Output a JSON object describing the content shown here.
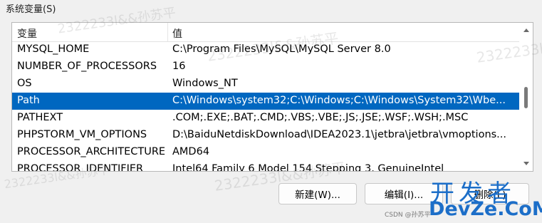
{
  "group_title": "系统变量(S)",
  "table": {
    "headers": {
      "name": "变量",
      "value": "值"
    },
    "rows": [
      {
        "name": "MYSQL_HOME",
        "value": "C:\\Program Files\\MySQL\\MySQL Server 8.0",
        "selected": false
      },
      {
        "name": "NUMBER_OF_PROCESSORS",
        "value": "16",
        "selected": false
      },
      {
        "name": "OS",
        "value": "Windows_NT",
        "selected": false
      },
      {
        "name": "Path",
        "value": "C:\\Windows\\system32;C:\\Windows;C:\\Windows\\System32\\Wbe...",
        "selected": true
      },
      {
        "name": "PATHEXT",
        "value": ".COM;.EXE;.BAT;.CMD;.VBS;.VBE;.JS;.JSE;.WSF;.WSH;.MSC",
        "selected": false
      },
      {
        "name": "PHPSTORM_VM_OPTIONS",
        "value": "D:\\BaiduNetdiskDownload\\IDEA2023.1\\jetbra\\jetbra\\vmoptions...",
        "selected": false
      },
      {
        "name": "PROCESSOR_ARCHITECTURE",
        "value": "AMD64",
        "selected": false
      },
      {
        "name": "PROCESSOR_IDENTIFIER",
        "value": "Intel64 Family 6 Model 154 Stepping 3, GenuineIntel",
        "selected": false
      }
    ]
  },
  "buttons": {
    "new": "新建(W)...",
    "edit": "编辑(I)...",
    "delete": "删除(L)"
  },
  "watermark_text": "2322233l&&孙苏平",
  "brand": {
    "line1": "开发者",
    "line2": "DevZe.CoM"
  },
  "csdn_text": "CSDN @孙苏平",
  "colors": {
    "selection": "#0067c0",
    "brand": "#1c6ec8"
  }
}
